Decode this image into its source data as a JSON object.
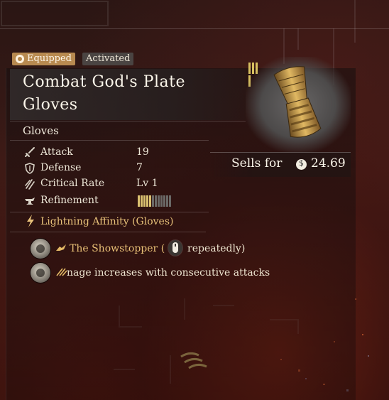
{
  "badges": {
    "equipped": "Equipped",
    "activated": "Activated"
  },
  "item": {
    "title": "Combat God's Plate Gloves",
    "category": "Gloves",
    "image_icon": "gauntlet-icon"
  },
  "sell": {
    "label": "Sells for",
    "value": "24.69",
    "icon": "coin-icon"
  },
  "stats": [
    {
      "label": "Attack",
      "value": "19",
      "icon": "sword-icon"
    },
    {
      "label": "Defense",
      "value": "7",
      "icon": "shield-icon"
    },
    {
      "label": "Critical Rate",
      "value": "Lv 1",
      "icon": "claw-icon"
    },
    {
      "label": "Refinement",
      "value": "",
      "icon": "anvil-icon"
    }
  ],
  "refinement": {
    "filled": 5,
    "total": 12
  },
  "affinity": {
    "label": "Lightning Affinity (Gloves)",
    "icon": "lightning-icon"
  },
  "skills": [
    {
      "title": "The Showstopper (",
      "suffix": "repeatedly)",
      "icon": "gold-skill-icon",
      "input_icon": "mouse-left-click-icon"
    },
    {
      "text": "nage increases with consecutive attacks",
      "icon": "gold-skill-icon"
    }
  ],
  "colors": {
    "accent_gold": "#e8c27a",
    "badge_equipped": "#b88a50",
    "badge_activated": "#4a4442"
  }
}
